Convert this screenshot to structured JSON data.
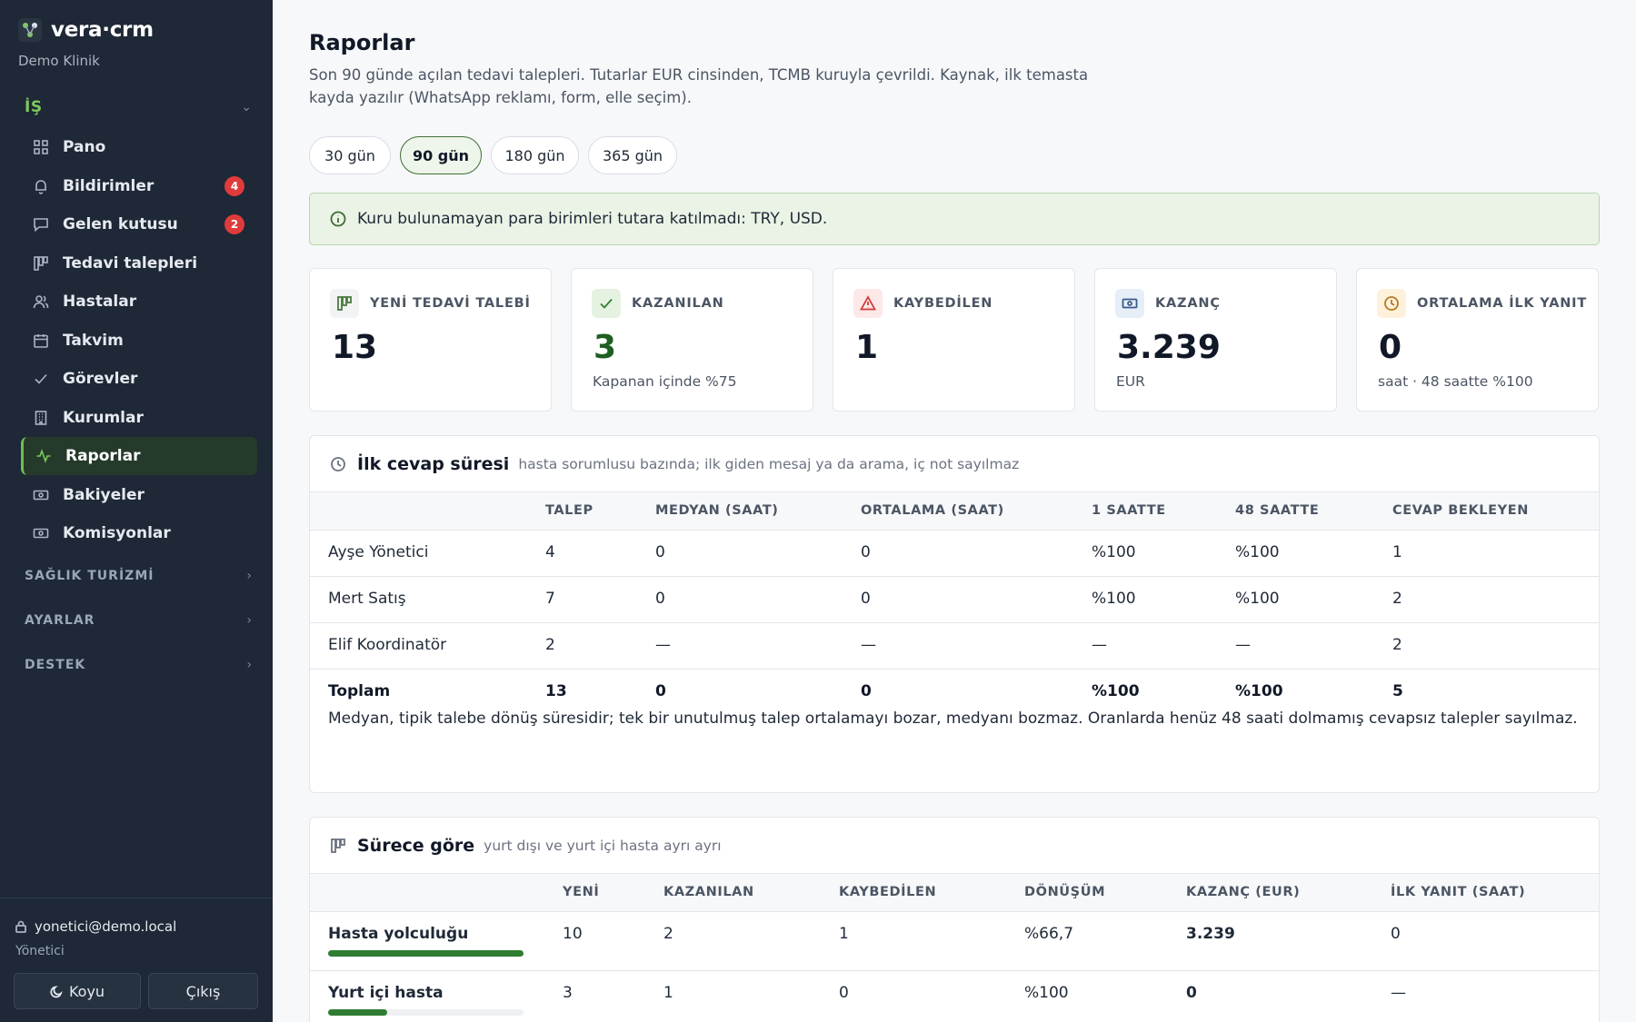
{
  "app": {
    "brand": "vera·crm",
    "org": "Demo Klinik"
  },
  "sidebar": {
    "group_is": "İŞ",
    "items": [
      {
        "label": "Pano",
        "icon": "grid-icon"
      },
      {
        "label": "Bildirimler",
        "icon": "bell-icon",
        "badge": "4"
      },
      {
        "label": "Gelen kutusu",
        "icon": "message-icon",
        "badge": "2"
      },
      {
        "label": "Tedavi talepleri",
        "icon": "kanban-icon"
      },
      {
        "label": "Hastalar",
        "icon": "users-icon"
      },
      {
        "label": "Takvim",
        "icon": "calendar-icon"
      },
      {
        "label": "Görevler",
        "icon": "check-icon"
      },
      {
        "label": "Kurumlar",
        "icon": "building-icon"
      },
      {
        "label": "Raporlar",
        "icon": "activity-icon",
        "active": true
      },
      {
        "label": "Bakiyeler",
        "icon": "cash-icon"
      },
      {
        "label": "Komisyonlar",
        "icon": "cash-icon"
      }
    ],
    "group_saglik": "SAĞLIK TURİZMİ",
    "group_ayarlar": "AYARLAR",
    "group_destek": "DESTEK",
    "user_email": "yonetici@demo.local",
    "user_role": "Yönetici",
    "dark_button": "Koyu",
    "logout_button": "Çıkış"
  },
  "page": {
    "title": "Raporlar",
    "description": "Son 90 günde açılan tedavi talepleri. Tutarlar EUR cinsinden, TCMB kuruyla çevrildi. Kaynak, ilk temasta kayda yazılır (WhatsApp reklamı, form, elle seçim).",
    "periods": [
      "30 gün",
      "90 gün",
      "180 gün",
      "365 gün"
    ],
    "active_period": "90 gün",
    "notice": "Kuru bulunamayan para birimleri tutara katılmadı: TRY, USD."
  },
  "kpis": [
    {
      "label": "YENİ TEDAVİ TALEBİ",
      "value": "13",
      "sub": "",
      "icon": "kanban-icon"
    },
    {
      "label": "KAZANILAN",
      "value": "3",
      "sub": "Kapanan içinde %75",
      "icon": "check-icon"
    },
    {
      "label": "KAYBEDİLEN",
      "value": "1",
      "sub": "",
      "icon": "alert-icon"
    },
    {
      "label": "KAZANÇ",
      "value": "3.239",
      "sub": "EUR",
      "icon": "cash-icon"
    },
    {
      "label": "ORTALAMA İLK YANIT",
      "value": "0",
      "sub": "saat · 48 saatte %100",
      "icon": "clock-icon"
    }
  ],
  "first_response": {
    "title": "İlk cevap süresi",
    "subtitle": "hasta sorumlusu bazında; ilk giden mesaj ya da arama, iç not sayılmaz",
    "columns": [
      "",
      "TALEP",
      "MEDYAN (SAAT)",
      "ORTALAMA (SAAT)",
      "1 SAATTE",
      "48 SAATTE",
      "CEVAP BEKLEYEN"
    ],
    "rows": [
      [
        "Ayşe Yönetici",
        "4",
        "0",
        "0",
        "%100",
        "%100",
        "1"
      ],
      [
        "Mert Satış",
        "7",
        "0",
        "0",
        "%100",
        "%100",
        "2"
      ],
      [
        "Elif Koordinatör",
        "2",
        "—",
        "—",
        "—",
        "—",
        "2"
      ]
    ],
    "total": [
      "Toplam",
      "13",
      "0",
      "0",
      "%100",
      "%100",
      "5"
    ],
    "note": "Medyan, tipik talebe dönüş süresidir; tek bir unutulmuş talep ortalamayı bozar, medyanı bozmaz. Oranlarda henüz 48 saati dolmamış cevapsız talepler sayılmaz."
  },
  "by_process": {
    "title": "Sürece göre",
    "subtitle": "yurt dışı ve yurt içi hasta ayrı ayrı",
    "columns": [
      "",
      "YENİ",
      "KAZANILAN",
      "KAYBEDİLEN",
      "DÖNÜŞÜM",
      "KAZANÇ (EUR)",
      "İLK YANIT (SAAT)"
    ],
    "rows": [
      {
        "cells": [
          "Hasta yolculuğu",
          "10",
          "2",
          "1",
          "%66,7",
          "3.239",
          "0"
        ],
        "share": 1.0
      },
      {
        "cells": [
          "Yurt içi hasta",
          "3",
          "1",
          "0",
          "%100",
          "0",
          "—"
        ],
        "share": 0.3
      }
    ]
  },
  "colors": {
    "accent": "#2f7d32",
    "sidebar": "#1e2836",
    "badge": "#e03b3b"
  }
}
